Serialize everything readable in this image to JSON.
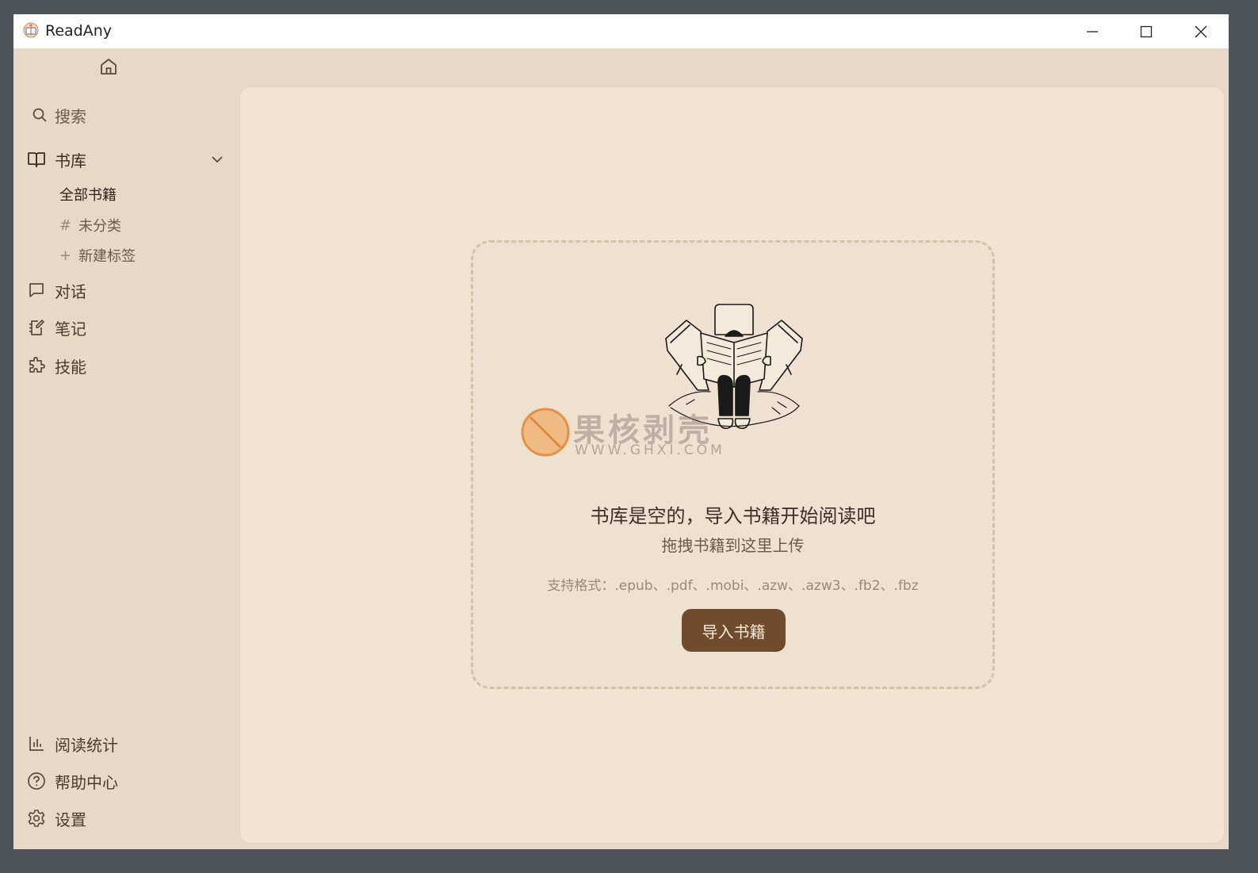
{
  "window": {
    "title": "ReadAny"
  },
  "sidebar": {
    "search_label": "搜索",
    "library_label": "书库",
    "library_sub": {
      "all": "全部书籍",
      "uncategorized_prefix": "#",
      "uncategorized": "未分类",
      "new_tag_prefix": "+",
      "new_tag": "新建标签"
    },
    "chat_label": "对话",
    "notes_label": "笔记",
    "skills_label": "技能",
    "stats_label": "阅读统计",
    "help_label": "帮助中心",
    "settings_label": "设置"
  },
  "main": {
    "empty_title": "书库是空的，导入书籍开始阅读吧",
    "empty_sub": "拖拽书籍到这里上传",
    "formats": "支持格式：.epub、.pdf、.mobi、.azw、.azw3、.fb2、.fbz",
    "import_button": "导入书籍"
  },
  "watermark": {
    "text": "果核剥壳",
    "url": "WWW.GHXI.COM"
  },
  "colors": {
    "sidebar_bg": "#e6d9c5",
    "panel_bg": "#f0e5d3",
    "accent": "#6f4c2e"
  }
}
